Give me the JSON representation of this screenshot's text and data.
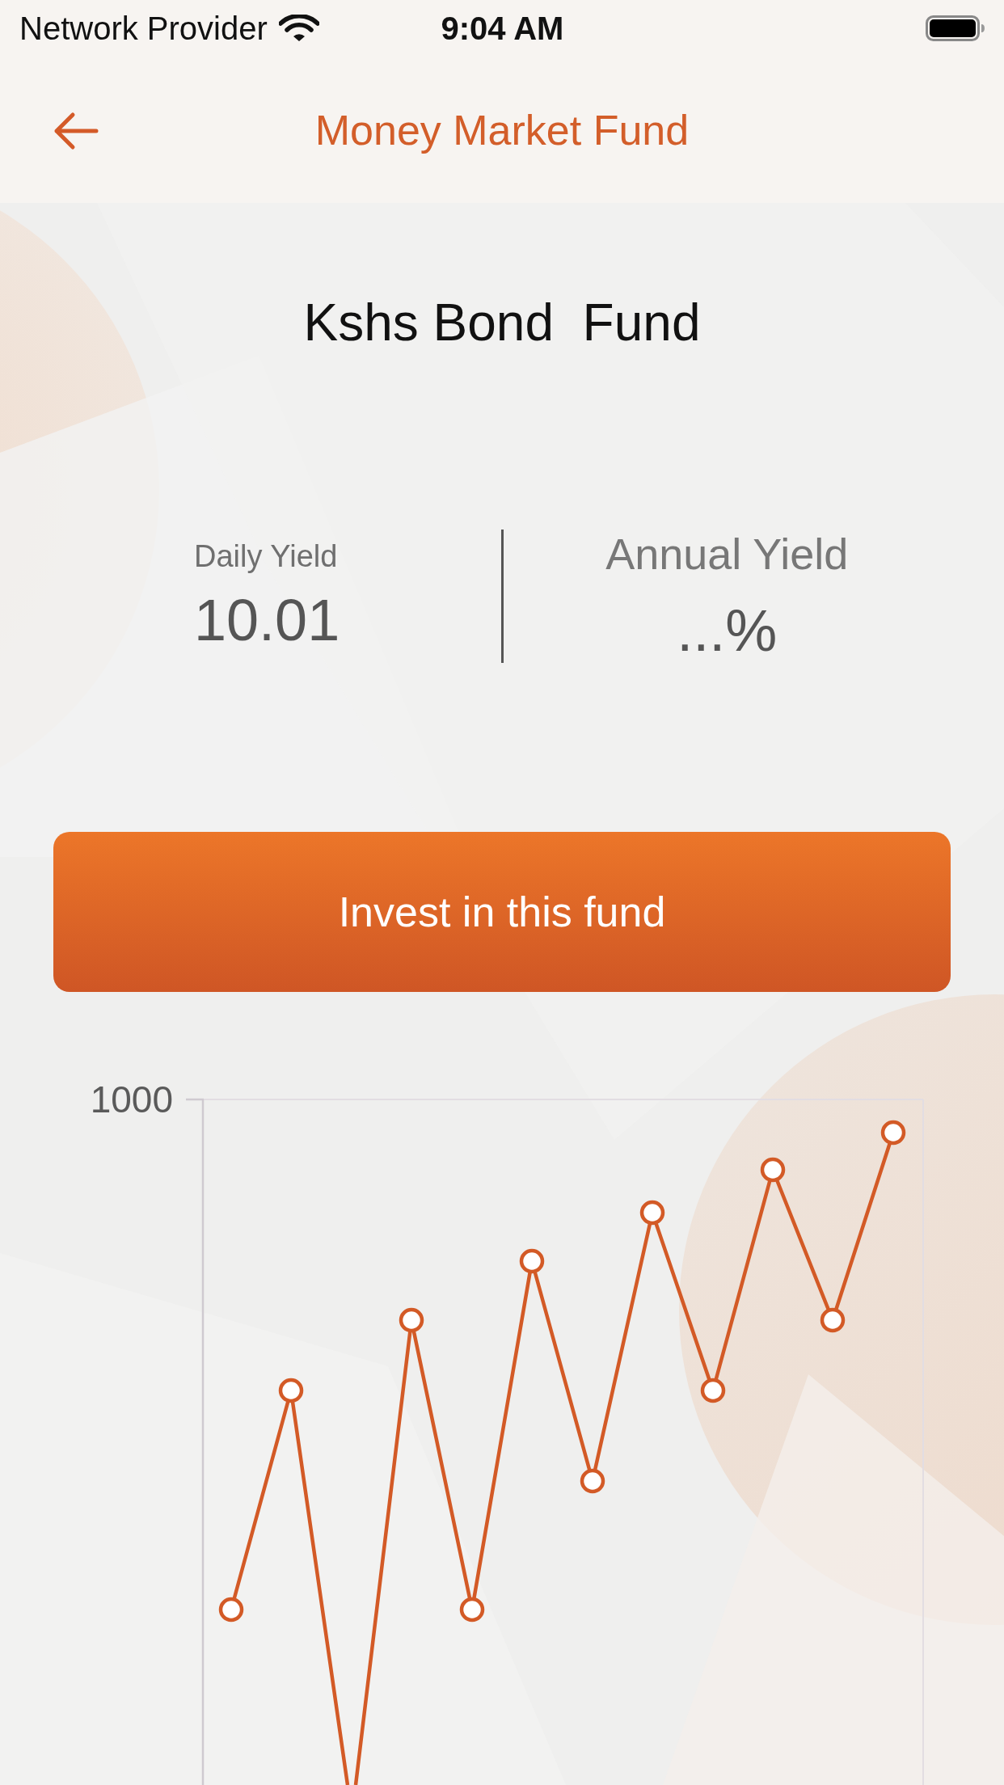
{
  "status_bar": {
    "carrier": "Network Provider",
    "time": "9:04 AM"
  },
  "header": {
    "title": "Money Market Fund"
  },
  "fund": {
    "name": "Kshs Bond  Fund"
  },
  "yields": [
    {
      "kind": "compact",
      "label": "Daily Yield",
      "value": "10.01"
    },
    {
      "kind": "large",
      "label": "Annual Yield",
      "value": "...%"
    }
  ],
  "invest_button": {
    "label": "Invest in this fund"
  },
  "chart": {
    "y_tick_label": "1000"
  }
}
